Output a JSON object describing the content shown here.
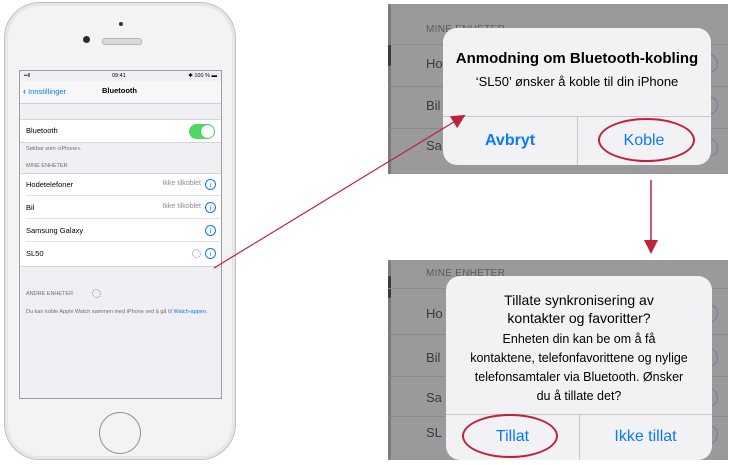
{
  "phone": {
    "status": {
      "signal": "••ll ",
      "time": "09:41",
      "battery": "✱ 100 % ▬"
    },
    "nav": {
      "back_label": "Innstillinger",
      "title": "Bluetooth"
    },
    "bluetooth_row": {
      "label": "Bluetooth",
      "toggle_on": true
    },
    "discoverable_text": "Søkbar som «iPhone».",
    "my_devices_header": "MINE ENHETER",
    "devices": [
      {
        "name": "Hodetelefoner",
        "status": "Ikke tilkoblet"
      },
      {
        "name": "Bil",
        "status": "Ikke tilkoblet"
      },
      {
        "name": "Samsung Galaxy",
        "status": ""
      },
      {
        "name": "SL50",
        "status": ""
      }
    ],
    "other_devices_header": "ANDRE ENHETER",
    "footer_text": "Du kan koble Apple Watch sammen med iPhone ved å gå til",
    "footer_link": "Watch-appen."
  },
  "top_zoom": {
    "header": "MINE ENHETER",
    "bg_labels": [
      "Ho",
      "Bil",
      "Sa"
    ],
    "alert": {
      "title": "Anmodning om Bluetooth-kobling",
      "message": "‘SL50’ ønsker å koble til din iPhone",
      "cancel": "Avbryt",
      "confirm": "Koble"
    }
  },
  "bottom_zoom": {
    "header": "MINE ENHETER",
    "bg_labels": [
      "Ho",
      "Bil",
      "Sa",
      "SL"
    ],
    "alert": {
      "title_line1": "Tillate synkronisering av",
      "title_line2": "kontakter og favoritter?",
      "message_lines": [
        "Enheten din kan be om å få",
        "kontaktene, telefonfavorittene og nylige",
        "telefonsamtaler via Bluetooth. Ønsker",
        "du å tillate det?"
      ],
      "allow": "Tillat",
      "deny": "Ikke tillat"
    }
  },
  "colors": {
    "accent": "#0a78fe",
    "toggle": "#4cd964",
    "annotation": "#c0203a"
  }
}
